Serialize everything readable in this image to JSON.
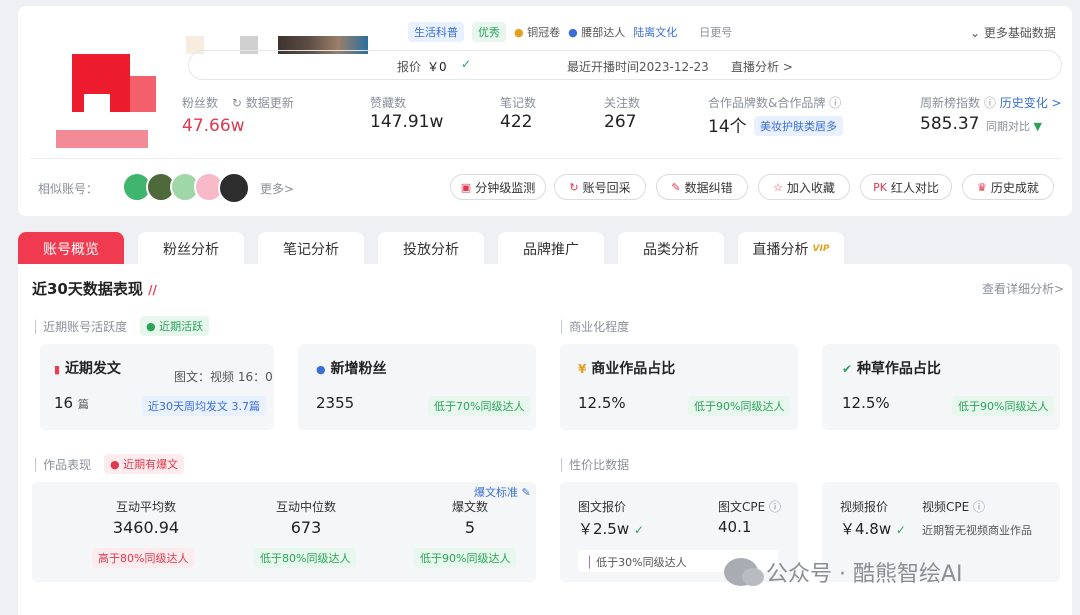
{
  "profile": {
    "tags": [
      "生活科普",
      "优秀",
      "铜冠卷",
      "腰部达人"
    ],
    "agency": "陆离文化",
    "daily_update": "日更号",
    "more_info": "更多基础数据",
    "quote_label": "报价",
    "quote_value": "￥0",
    "last_live": "最近开播时间2023-12-23",
    "live_analysis": "直播分析 >",
    "fans_label": "粉丝数",
    "data_update": "数据更新",
    "fans_value": "47.66w",
    "likes_label": "赞藏数",
    "likes_value": "147.91w",
    "notes_label": "笔记数",
    "notes_value": "422",
    "follow_label": "关注数",
    "follow_value": "267",
    "brand_label": "合作品牌数&合作品牌",
    "brand_value": "14个",
    "brand_tag": "美妆护肤类居多",
    "rank_label": "周新榜指数",
    "rank_history": "历史变化 >",
    "rank_value": "585.37",
    "rank_compare": "同期对比",
    "similar_label": "相似账号：",
    "similar_more": "更多>"
  },
  "actions": [
    "分钟级监测",
    "账号回采",
    "数据纠错",
    "加入收藏",
    "红人对比",
    "历史成就"
  ],
  "tabs": [
    "账号概览",
    "粉丝分析",
    "笔记分析",
    "投放分析",
    "品牌推广",
    "品类分析",
    "直播分析"
  ],
  "vip": "VIP",
  "section": {
    "title": "近30天数据表现",
    "detail": "查看详细分析>",
    "activity_label": "近期账号活跃度",
    "activity_tag": "近期活跃",
    "commercial_label": "商业化程度",
    "works_label": "作品表现",
    "works_tag": "近期有爆文",
    "value_label": "性价比数据"
  },
  "recent_post": {
    "title": "近期发文",
    "ratio": "图文：视频 16：0",
    "value": "16",
    "unit": "篇",
    "tag": "近30天周均发文 3.7篇"
  },
  "new_fans": {
    "title": "新增粉丝",
    "value": "2355",
    "tag": "低于70%同级达人"
  },
  "commercial_share": {
    "title": "商业作品占比",
    "value": "12.5%",
    "tag": "低于90%同级达人"
  },
  "seed_share": {
    "title": "种草作品占比",
    "value": "12.5%",
    "tag": "低于90%同级达人"
  },
  "works": {
    "standard": "爆文标准",
    "items": [
      {
        "label": "互动平均数",
        "value": "3460.94",
        "tag": "高于80%同级达人"
      },
      {
        "label": "互动中位数",
        "value": "673",
        "tag": "低于80%同级达人"
      },
      {
        "label": "爆文数",
        "value": "5",
        "tag": "低于90%同级达人"
      }
    ]
  },
  "graphic": {
    "price_label": "图文报价",
    "price_value": "￥2.5w",
    "cpe_label": "图文CPE",
    "cpe_value": "40.1",
    "tag": "低于30%同级达人"
  },
  "video": {
    "price_label": "视频报价",
    "price_value": "￥4.8w",
    "cpe_label": "视频CPE",
    "cpe_note": "近期暂无视频商业作品"
  },
  "watermark": "公众号 · 酷熊智绘AI",
  "colors": {
    "accent": "#ef3a4f",
    "green": "#2ba45a",
    "blue": "#3a6fd8"
  }
}
